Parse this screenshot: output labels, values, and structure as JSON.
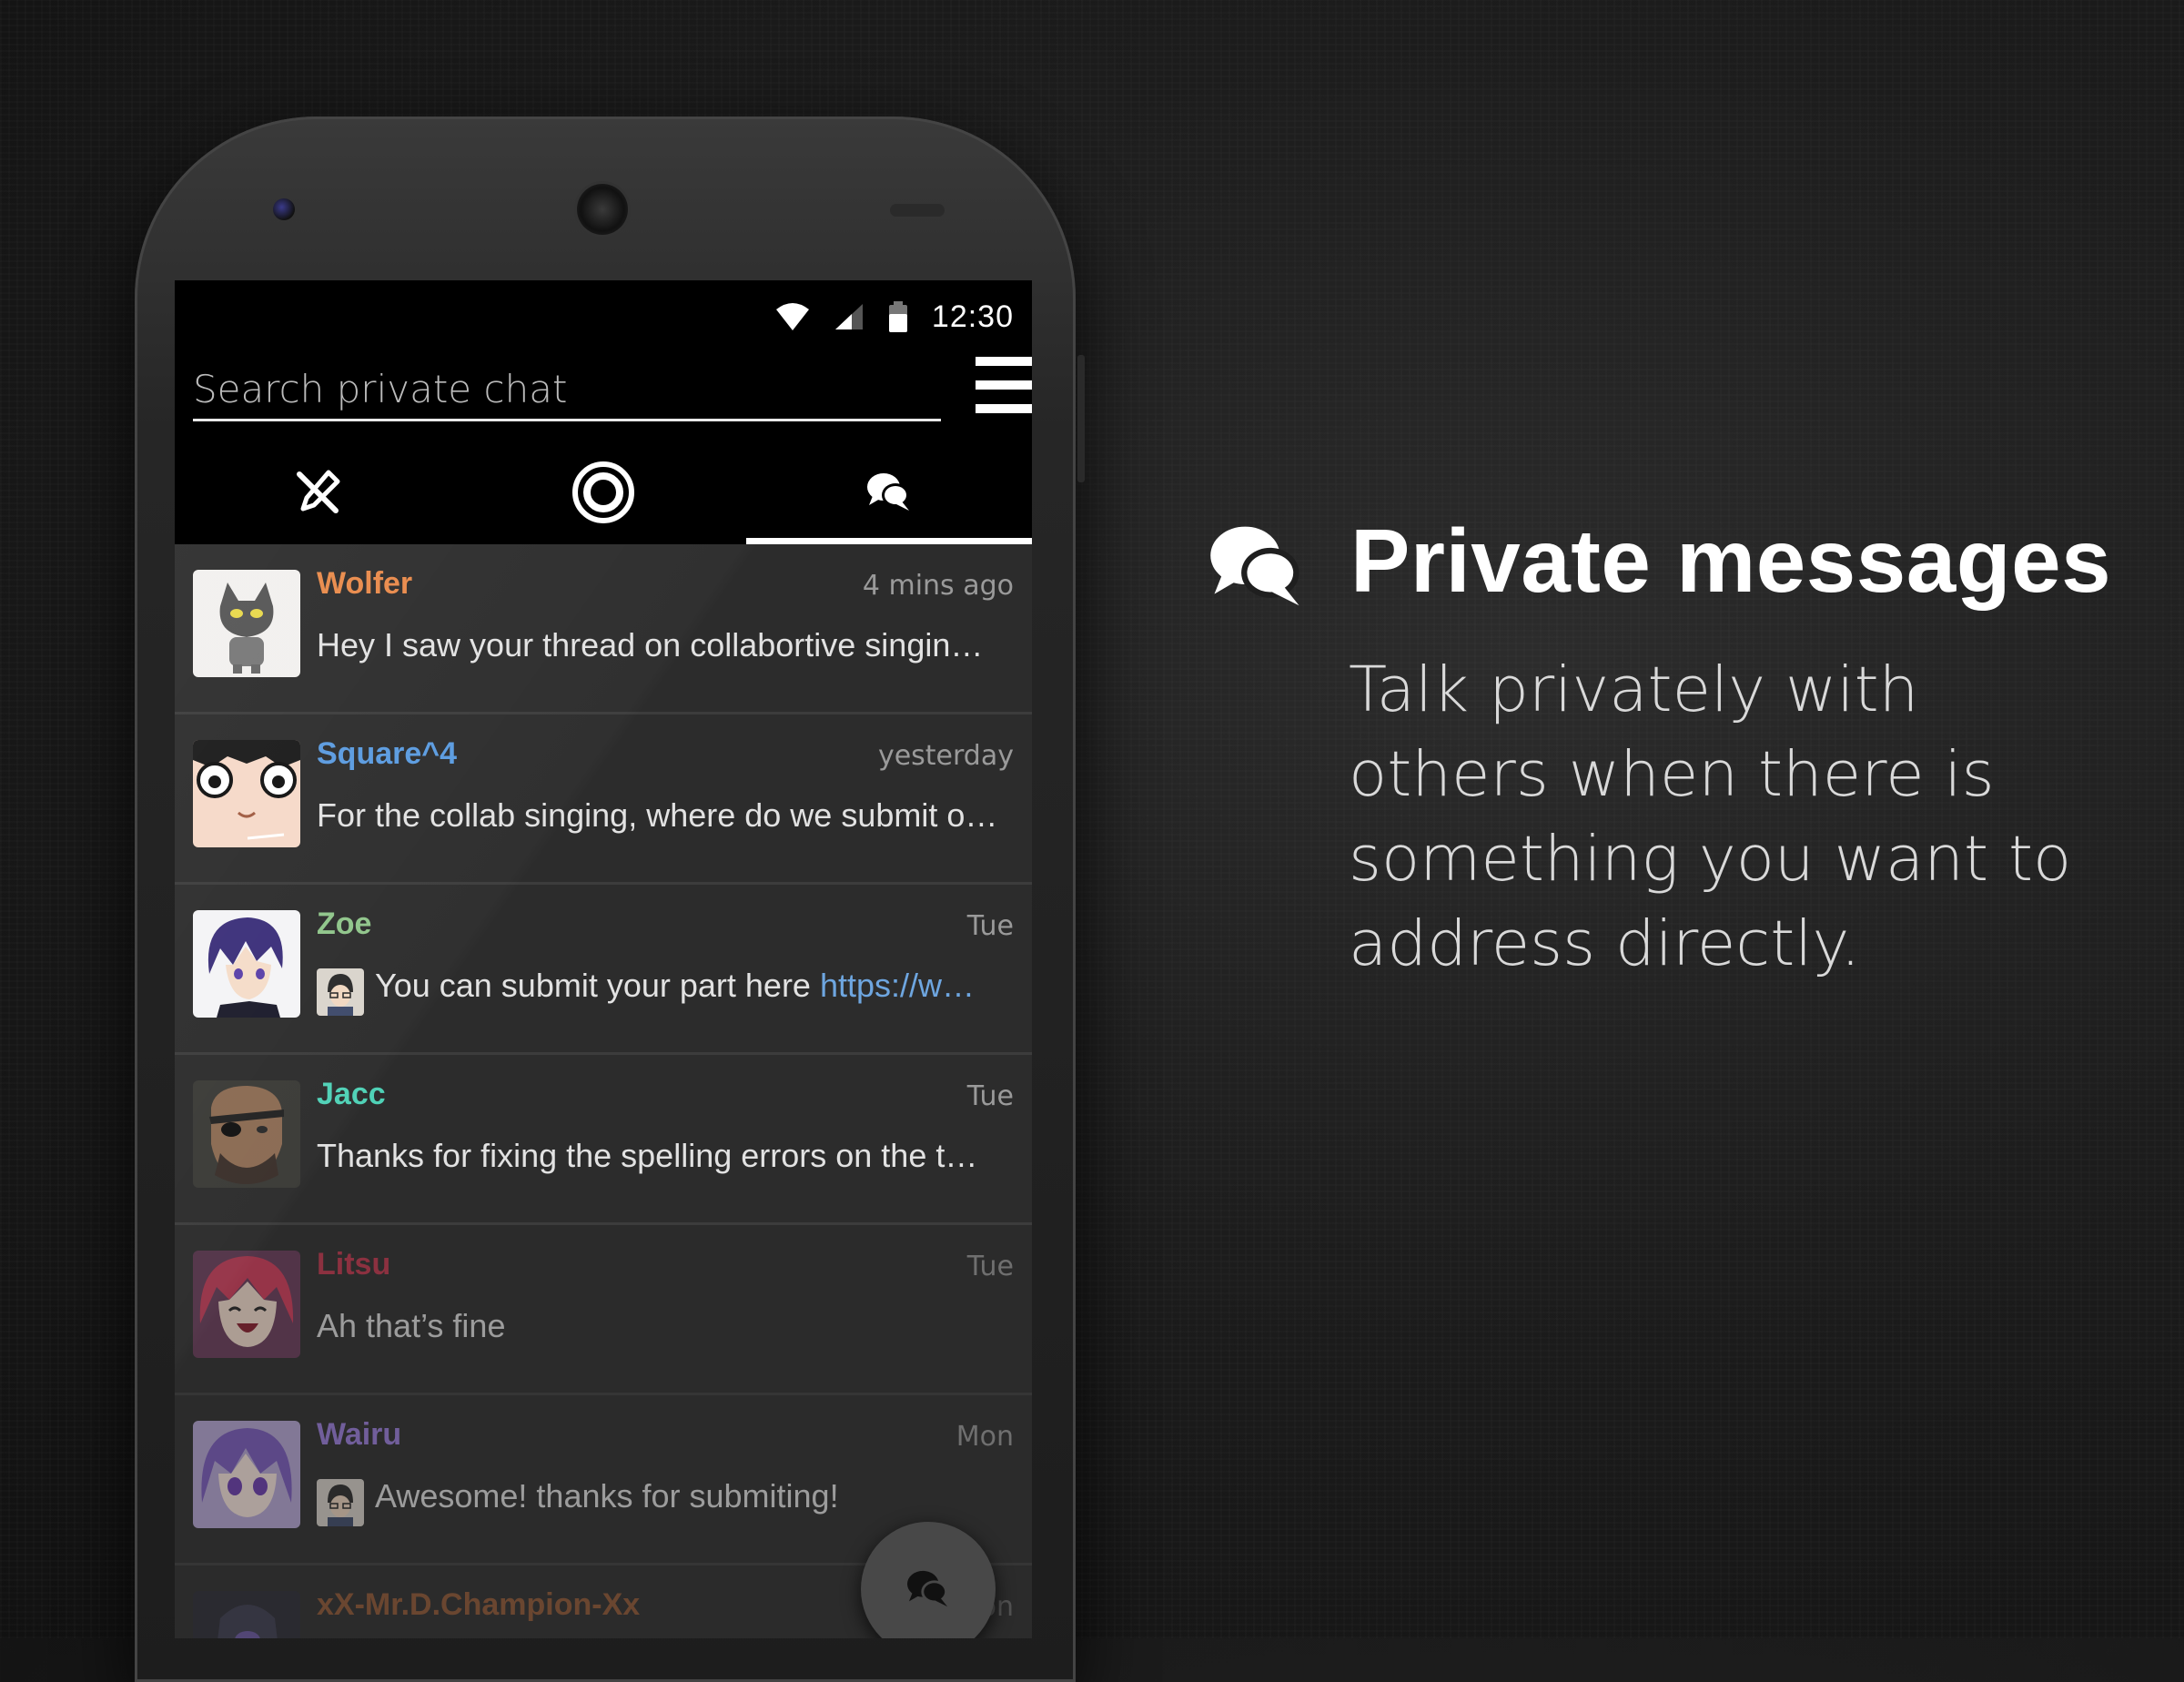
{
  "status_bar": {
    "time": "12:30"
  },
  "search": {
    "placeholder": "Search private chat"
  },
  "tabs": [
    {
      "name": "tab-tools",
      "icon": "tools-icon"
    },
    {
      "name": "tab-target",
      "icon": "target-icon"
    },
    {
      "name": "tab-chat",
      "icon": "chat-bubbles-icon",
      "active": true
    }
  ],
  "conversations": [
    {
      "name": "Wolfer",
      "name_color": "#e98a4a",
      "time": "4 mins ago",
      "message": "Hey I saw your thread on collabortive singin…"
    },
    {
      "name": "Square^4",
      "name_color": "#5a9be0",
      "time": "yesterday",
      "message": "For the collab singing, where do we submit o…"
    },
    {
      "name": "Zoe",
      "name_color": "#8fc58a",
      "time": "Tue",
      "message": "You can submit your part here ",
      "link": "https://w…"
    },
    {
      "name": "Jacc",
      "name_color": "#4fd1b6",
      "time": "Tue",
      "message": "Thanks for fixing the spelling errors on the t…"
    },
    {
      "name": "Litsu",
      "name_color": "#c8364d",
      "time": "Tue",
      "message": "Ah that’s fine"
    },
    {
      "name": "Wairu",
      "name_color": "#9c7ee0",
      "time": "Mon",
      "message": "Awesome! thanks for submiting!"
    },
    {
      "name": "xX-Mr.D.Champion-Xx",
      "name_color": "#e07a3a",
      "time": "Mon",
      "message": ""
    }
  ],
  "promo": {
    "title": "Private messages",
    "description": "Talk privately with others when there is something you want to address directly."
  }
}
